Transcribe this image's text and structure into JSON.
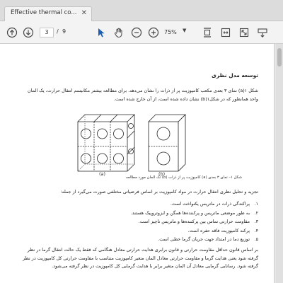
{
  "window": {
    "tab_title": "Effective thermal co..."
  },
  "toolbar": {
    "current_page": "3",
    "page_separator": "/",
    "total_pages": "9",
    "zoom": "75%",
    "icons": [
      "arrow-up-circle-icon",
      "arrow-down-circle-icon",
      "pointer-icon",
      "hand-icon",
      "zoom-out-icon",
      "zoom-in-icon",
      "fit-page-icon",
      "fit-width-icon",
      "fullscreen-icon",
      "sign-icon"
    ]
  },
  "doc": {
    "section_heading": "توسعه مدل نظری",
    "para1": "شکل ۱(a) نمای ۳ بعدی مکعب کامپوزیت پر از ذرات را نشان می‌دهد. برای مطالعه بیشتر مکانیسم انتقال حرارت، یک المان واحد همانطور که در شکل۱(b) نشان داده شده است، از آن خارج شده است.",
    "figure_label_a": "(a)",
    "figure_label_b": "(b)",
    "figure_caption": "شکل ۱– نمای ۳ بعدی (a) کامپوزیت پر از ذرات (b) تک المان مورد مطالعه",
    "para2": "تجزیه و تحلیل نظری انتقال حرارت در مواد کامپوزیت بر اساس فرضیاتی مختلفی صورت می‌گیرد از جمله:",
    "list": [
      {
        "num": "۱.",
        "text": "پراکندگی ذرات در ماتریس یکنواخت است."
      },
      {
        "num": "۲.",
        "text": "به طور موضعی ماتریس و پرکننده‌ها همگن و ایزوتروپیک هستند."
      },
      {
        "num": "۳.",
        "text": "مقاومت حرارتی تماس بین پرکننده‌ها و ماتریس ناچیز است."
      },
      {
        "num": "۴.",
        "text": "پرکنه کامپوزیت فاقد حفره است."
      },
      {
        "num": "۵.",
        "text": "توزیع دما در امتداد جهت جریان گرما خطی است."
      }
    ],
    "para3": "بر اساس قانون حداقل مقاومت حرارتی و قانون برابری هدایت حرارتی معادل هنگامی که فقط یک حالت انتقال گرما در نظر گرفته شود یعنی هدایت گرما و مقاومت حرارتی معادل المان متغیر کامپوزیت متناسب با مقاومت حرارتی کل کامپوزیت در نظر گرفته شود. رسانایی گرمایی معادل آن المان متغیر برابر با هدایت گرمایی کل کامپوزیت در نظر گرفته می‌شود."
  }
}
